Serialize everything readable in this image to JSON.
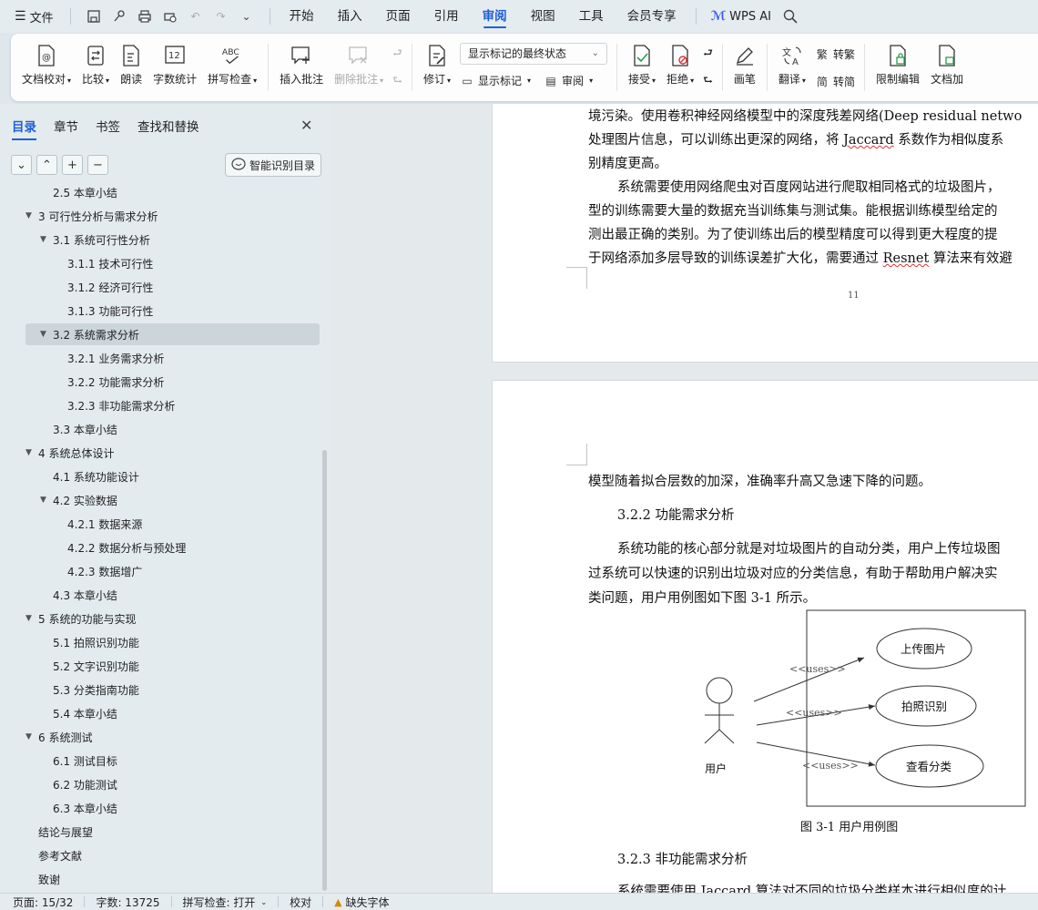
{
  "menubar": {
    "file_label": "文件",
    "tabs": [
      "开始",
      "插入",
      "页面",
      "引用",
      "审阅",
      "视图",
      "工具",
      "会员专享"
    ],
    "active_tab": "审阅",
    "wps_ai": "WPS AI"
  },
  "ribbon": {
    "doc_check": "文档校对",
    "compare": "比较",
    "read_aloud": "朗读",
    "word_count": "字数统计",
    "spell_check": "拼写检查",
    "insert_comment": "插入批注",
    "delete_comment": "删除批注",
    "revise": "修订",
    "display_mode": "显示标记的最终状态",
    "show_markup": "显示标记",
    "review": "审阅",
    "accept": "接受",
    "reject": "拒绝",
    "pen": "画笔",
    "translate": "翻译",
    "to_traditional": "转繁",
    "to_simplified": "转简",
    "restrict_edit": "限制编辑",
    "doc_protect": "文档加"
  },
  "sidebar": {
    "tabs": [
      "目录",
      "章节",
      "书签",
      "查找和替换"
    ],
    "smart_toc": "智能识别目录",
    "toc": [
      {
        "text": "2.5  本章小结",
        "level": 1,
        "tri": ""
      },
      {
        "text": "3 可行性分析与需求分析",
        "level": 0,
        "tri": "▼"
      },
      {
        "text": "3.1  系统可行性分析",
        "level": 1,
        "tri": "▼"
      },
      {
        "text": "3.1.1 技术可行性",
        "level": 2,
        "tri": ""
      },
      {
        "text": "3.1.2 经济可行性",
        "level": 2,
        "tri": ""
      },
      {
        "text": "3.1.3 功能可行性",
        "level": 2,
        "tri": ""
      },
      {
        "text": "3.2  系统需求分析",
        "level": 1,
        "tri": "▼",
        "selected": true
      },
      {
        "text": "3.2.1  业务需求分析",
        "level": 2,
        "tri": ""
      },
      {
        "text": "3.2.2  功能需求分析",
        "level": 2,
        "tri": ""
      },
      {
        "text": "3.2.3  非功能需求分析",
        "level": 2,
        "tri": ""
      },
      {
        "text": "3.3  本章小结",
        "level": 1,
        "tri": ""
      },
      {
        "text": "4  系统总体设计",
        "level": 0,
        "tri": "▼"
      },
      {
        "text": "4.1  系统功能设计",
        "level": 1,
        "tri": ""
      },
      {
        "text": "4.2  实验数据",
        "level": 1,
        "tri": "▼"
      },
      {
        "text": "4.2.1  数据来源",
        "level": 2,
        "tri": ""
      },
      {
        "text": "4.2.2  数据分析与预处理",
        "level": 2,
        "tri": ""
      },
      {
        "text": "4.2.3  数据增广",
        "level": 2,
        "tri": ""
      },
      {
        "text": "4.3  本章小结",
        "level": 1,
        "tri": ""
      },
      {
        "text": "5  系统的功能与实现",
        "level": 0,
        "tri": "▼"
      },
      {
        "text": "5.1  拍照识别功能",
        "level": 1,
        "tri": ""
      },
      {
        "text": "5.2  文字识别功能",
        "level": 1,
        "tri": ""
      },
      {
        "text": "5.3  分类指南功能",
        "level": 1,
        "tri": ""
      },
      {
        "text": "5.4  本章小结",
        "level": 1,
        "tri": ""
      },
      {
        "text": "6  系统测试",
        "level": 0,
        "tri": "▼"
      },
      {
        "text": "6.1  测试目标",
        "level": 1,
        "tri": ""
      },
      {
        "text": "6.2  功能测试",
        "level": 1,
        "tri": ""
      },
      {
        "text": "6.3  本章小结",
        "level": 1,
        "tri": ""
      },
      {
        "text": "结论与展望",
        "level": 0,
        "tri": ""
      },
      {
        "text": "参考文献",
        "level": 0,
        "tri": ""
      },
      {
        "text": "致谢",
        "level": 0,
        "tri": ""
      }
    ]
  },
  "page1": {
    "l1": "境污染。使用卷积神经网络模型中的深度残差网络(Deep residual netwo",
    "l2a": "处理图片信息，可以训练出更深的网络，将 ",
    "l2b": "Jaccard",
    "l2c": " 系数作为相似度系",
    "l3": "别精度更高。",
    "l4": "系统需要使用网络爬虫对百度网站进行爬取相同格式的垃圾图片，",
    "l5": "型的训练需要大量的数据充当训练集与测试集。能根据训练模型给定的",
    "l6": "测出最正确的类别。为了使训练出后的模型精度可以得到更大程度的提",
    "l7a": "于网络添加多层导致的训练误差扩大化，需要通过 ",
    "l7b": "Resnet",
    "l7c": " 算法来有效避",
    "page_number": "11"
  },
  "page2": {
    "l1": "模型随着拟合层数的加深，准确率升高又急速下降的问题。",
    "heading1": "3.2.2 功能需求分析",
    "p1": "系统功能的核心部分就是对垃圾图片的自动分类，用户上传垃圾图",
    "p2": "过系统可以快速的识别出垃圾对应的分类信息，有助于帮助用户解决实",
    "p3": "类问题，用户用例图如下图 3-1 所示。",
    "diagram": {
      "actor": "用户",
      "use_cases": [
        "上传图片",
        "拍照识别",
        "查看分类"
      ],
      "relation": "<<uses>>"
    },
    "caption": "图 3-1 用户用例图",
    "heading2": "3.2.3 非功能需求分析",
    "p4": "系统需要使用 Jaccard 算法对不同的垃圾分类样本进行相似度的计"
  },
  "status": {
    "page": "页面: 15/32",
    "words": "字数: 13725",
    "spell": "拼写检查: 打开",
    "proof": "校对",
    "missing_font": "缺失字体"
  }
}
